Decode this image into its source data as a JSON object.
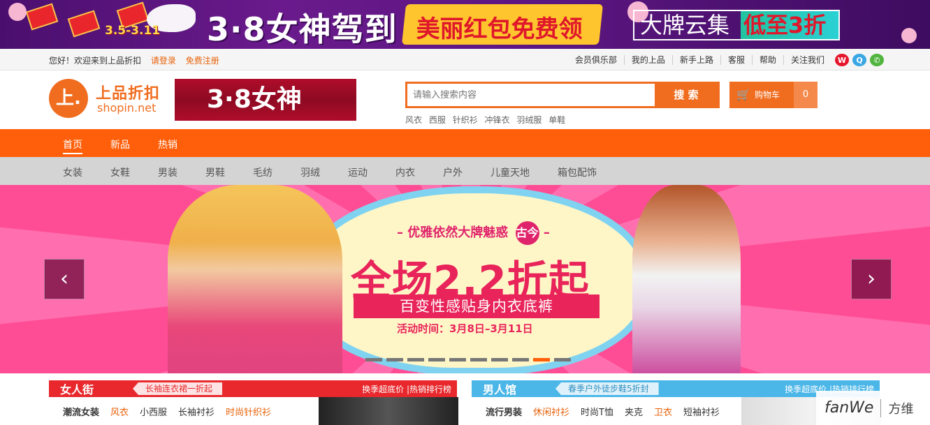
{
  "promo": {
    "dates": "3.5-3.11",
    "title": "3·8女神驾到",
    "ribbon": "美丽红包免费领",
    "brand_a": "大牌云集",
    "brand_b": "低至3折"
  },
  "topbar": {
    "greeting": "您好！欢迎来到上品折扣",
    "login": "请登录",
    "register": "免费注册",
    "links": [
      "会员俱乐部",
      "我的上品",
      "新手上路",
      "客服",
      "帮助",
      "关注我们"
    ]
  },
  "header": {
    "logo_mark": "上.",
    "logo_cn": "上品折扣",
    "logo_en": "shopin.net",
    "ad_text": "3·8女神",
    "search_placeholder": "请输入搜索内容",
    "search_button": "搜 索",
    "hotwords": [
      "风衣",
      "西服",
      "针织衫",
      "冲锋衣",
      "羽绒服",
      "单鞋"
    ],
    "cart_icon": "cart-icon",
    "cart_label": "购物车",
    "cart_count": "0"
  },
  "mainnav": [
    "首页",
    "新品",
    "热销"
  ],
  "catnav": [
    "女装",
    "女鞋",
    "男装",
    "男鞋",
    "毛纺",
    "羽绒",
    "运动",
    "内衣",
    "户外",
    "儿童天地",
    "箱包配饰"
  ],
  "hero": {
    "subline": "– 优雅依然大牌魅惑",
    "badge": "古今",
    "subline_end": "–",
    "headline": "全场2.2折起",
    "bar": "百变性感贴身内衣底裤",
    "time": "活动时间：3月8日–3月11日",
    "prev": "‹",
    "next": "›",
    "active_slide": 9,
    "slide_count": 10
  },
  "floors": [
    {
      "name": "女人街",
      "tag": "长袖连衣裙一折起",
      "links": [
        "换季超底价",
        "|热销排行榜"
      ],
      "sub_lead": "潮流女装",
      "sub": [
        "风衣",
        "小西服",
        "长袖衬衫",
        "时尚针织衫"
      ],
      "color": "#e8282c",
      "tag_bg": "#fde3e3",
      "tag_color": "#e8282c"
    },
    {
      "name": "男人馆",
      "tag": "春季户外徒步鞋5折封",
      "links": [
        "换季超底价",
        "|热销排行榜"
      ],
      "sub_lead": "流行男装",
      "sub": [
        "休闲衬衫",
        "时尚T恤",
        "夹克",
        "卫衣",
        "短袖衬衫"
      ],
      "color": "#4bb6e8",
      "tag_bg": "#dff2fb",
      "tag_color": "#2f8fc0"
    }
  ],
  "watermark": {
    "a": "fanWe",
    "b": "方维"
  },
  "colors": {
    "brand_orange": "#ff5f0a",
    "nav_gray": "#d4d4d4",
    "hero_pink": "#ff4d95"
  }
}
